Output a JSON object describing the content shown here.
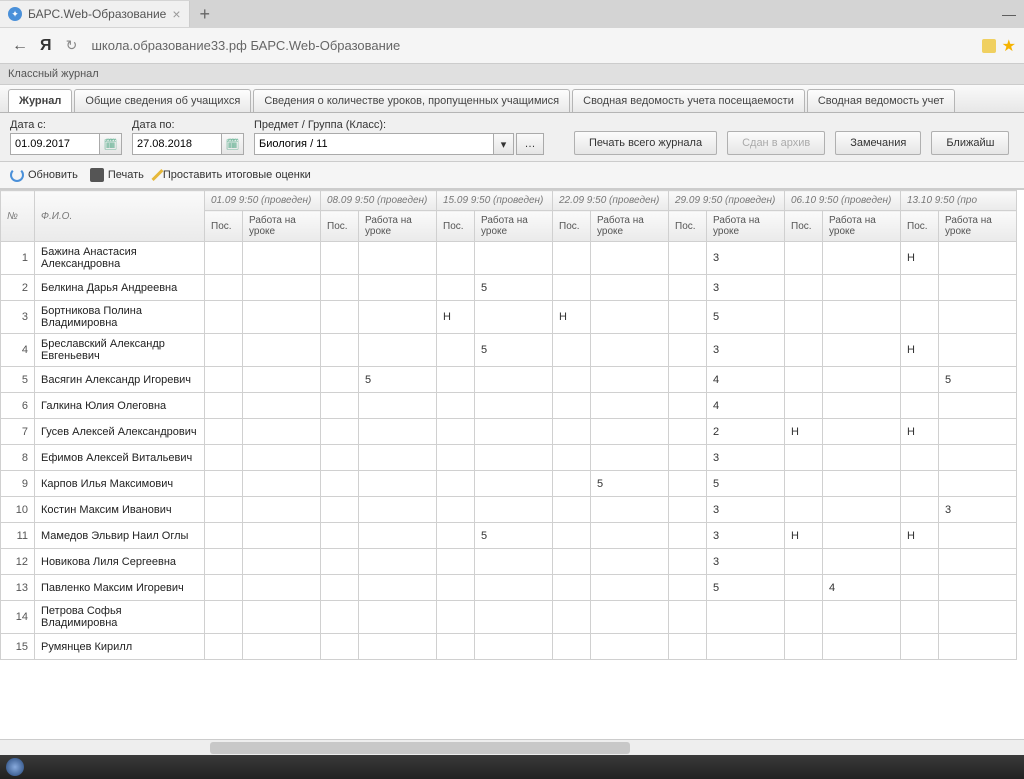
{
  "browser": {
    "tab_title": "БАРС.Web-Образование",
    "url_display": "школа.образование33.рф  БАРС.Web-Образование"
  },
  "breadcrumb": "Классный журнал",
  "tabs": [
    {
      "label": "Журнал",
      "active": true
    },
    {
      "label": "Общие сведения об учащихся",
      "active": false
    },
    {
      "label": "Сведения о количестве уроков, пропущенных учащимися",
      "active": false
    },
    {
      "label": "Сводная ведомость учета посещаемости",
      "active": false
    },
    {
      "label": "Сводная ведомость учет",
      "active": false
    }
  ],
  "filters": {
    "date_from_label": "Дата с:",
    "date_from": "01.09.2017",
    "date_to_label": "Дата по:",
    "date_to": "27.08.2018",
    "subject_label": "Предмет / Группа (Класс):",
    "subject": "Биология / 11"
  },
  "actions": {
    "print_all": "Печать всего журнала",
    "archive": "Сдан в архив",
    "remarks": "Замечания",
    "nearest": "Ближайш"
  },
  "toolbar": {
    "refresh": "Обновить",
    "print": "Печать",
    "set_final": "Проставить итоговые оценки"
  },
  "grid": {
    "col_num": "№",
    "col_fio": "Ф.И.О.",
    "col_pos": "Пос.",
    "col_work": "Работа на уроке",
    "dates": [
      "01.09 9:50 (проведен)",
      "08.09 9:50 (проведен)",
      "15.09 9:50 (проведен)",
      "22.09 9:50 (проведен)",
      "29.09 9:50 (проведен)",
      "06.10 9:50 (проведен)",
      "13.10 9:50 (про"
    ],
    "rows": [
      {
        "n": "1",
        "name": "Бажина Анастасия Александровна",
        "c": [
          [
            "",
            ""
          ],
          [
            "",
            ""
          ],
          [
            "",
            ""
          ],
          [
            "",
            ""
          ],
          [
            "",
            "3"
          ],
          [
            "",
            ""
          ],
          [
            "Н",
            ""
          ]
        ]
      },
      {
        "n": "2",
        "name": "Белкина Дарья Андреевна",
        "c": [
          [
            "",
            ""
          ],
          [
            "",
            ""
          ],
          [
            "",
            "5"
          ],
          [
            "",
            ""
          ],
          [
            "",
            "3"
          ],
          [
            "",
            ""
          ],
          [
            "",
            ""
          ]
        ]
      },
      {
        "n": "3",
        "name": "Бортникова Полина Владимировна",
        "c": [
          [
            "",
            ""
          ],
          [
            "",
            ""
          ],
          [
            "Н",
            ""
          ],
          [
            "Н",
            ""
          ],
          [
            "",
            "5"
          ],
          [
            "",
            ""
          ],
          [
            "",
            ""
          ]
        ]
      },
      {
        "n": "4",
        "name": "Бреславский Александр Евгеньевич",
        "c": [
          [
            "",
            ""
          ],
          [
            "",
            ""
          ],
          [
            "",
            "5"
          ],
          [
            "",
            ""
          ],
          [
            "",
            "3"
          ],
          [
            "",
            ""
          ],
          [
            "Н",
            ""
          ]
        ]
      },
      {
        "n": "5",
        "name": "Васягин Александр Игоревич",
        "c": [
          [
            "",
            ""
          ],
          [
            "",
            "5"
          ],
          [
            "",
            ""
          ],
          [
            "",
            ""
          ],
          [
            "",
            "4"
          ],
          [
            "",
            ""
          ],
          [
            "",
            "5"
          ]
        ]
      },
      {
        "n": "6",
        "name": "Галкина Юлия Олеговна",
        "c": [
          [
            "",
            ""
          ],
          [
            "",
            ""
          ],
          [
            "",
            ""
          ],
          [
            "",
            ""
          ],
          [
            "",
            "4"
          ],
          [
            "",
            ""
          ],
          [
            "",
            ""
          ]
        ]
      },
      {
        "n": "7",
        "name": "Гусев Алексей Александрович",
        "c": [
          [
            "",
            ""
          ],
          [
            "",
            ""
          ],
          [
            "",
            ""
          ],
          [
            "",
            ""
          ],
          [
            "",
            "2"
          ],
          [
            "Н",
            ""
          ],
          [
            "Н",
            ""
          ]
        ]
      },
      {
        "n": "8",
        "name": "Ефимов Алексей Витальевич",
        "c": [
          [
            "",
            ""
          ],
          [
            "",
            ""
          ],
          [
            "",
            ""
          ],
          [
            "",
            ""
          ],
          [
            "",
            "3"
          ],
          [
            "",
            ""
          ],
          [
            "",
            ""
          ]
        ]
      },
      {
        "n": "9",
        "name": "Карпов Илья Максимович",
        "c": [
          [
            "",
            ""
          ],
          [
            "",
            ""
          ],
          [
            "",
            ""
          ],
          [
            "",
            "5"
          ],
          [
            "",
            "5"
          ],
          [
            "",
            ""
          ],
          [
            "",
            ""
          ]
        ]
      },
      {
        "n": "10",
        "name": "Костин Максим Иванович",
        "c": [
          [
            "",
            ""
          ],
          [
            "",
            ""
          ],
          [
            "",
            ""
          ],
          [
            "",
            ""
          ],
          [
            "",
            "3"
          ],
          [
            "",
            ""
          ],
          [
            "",
            "3"
          ]
        ]
      },
      {
        "n": "11",
        "name": "Мамедов Эльвир Наил Оглы",
        "c": [
          [
            "",
            ""
          ],
          [
            "",
            ""
          ],
          [
            "",
            "5"
          ],
          [
            "",
            ""
          ],
          [
            "",
            "3"
          ],
          [
            "Н",
            ""
          ],
          [
            "Н",
            ""
          ]
        ]
      },
      {
        "n": "12",
        "name": "Новикова Лиля Сергеевна",
        "c": [
          [
            "",
            ""
          ],
          [
            "",
            ""
          ],
          [
            "",
            ""
          ],
          [
            "",
            ""
          ],
          [
            "",
            "3"
          ],
          [
            "",
            ""
          ],
          [
            "",
            ""
          ]
        ]
      },
      {
        "n": "13",
        "name": "Павленко Максим Игоревич",
        "c": [
          [
            "",
            ""
          ],
          [
            "",
            ""
          ],
          [
            "",
            ""
          ],
          [
            "",
            ""
          ],
          [
            "",
            "5"
          ],
          [
            "",
            "4"
          ],
          [
            "",
            ""
          ]
        ]
      },
      {
        "n": "14",
        "name": "Петрова Софья Владимировна",
        "c": [
          [
            "",
            ""
          ],
          [
            "",
            ""
          ],
          [
            "",
            ""
          ],
          [
            "",
            ""
          ],
          [
            "",
            ""
          ],
          [
            "",
            ""
          ],
          [
            "",
            ""
          ]
        ]
      },
      {
        "n": "15",
        "name": "Румянцев Кирилл",
        "c": [
          [
            "",
            ""
          ],
          [
            "",
            ""
          ],
          [
            "",
            ""
          ],
          [
            "",
            ""
          ],
          [
            "",
            ""
          ],
          [
            "",
            ""
          ],
          [
            "",
            ""
          ]
        ]
      }
    ]
  }
}
